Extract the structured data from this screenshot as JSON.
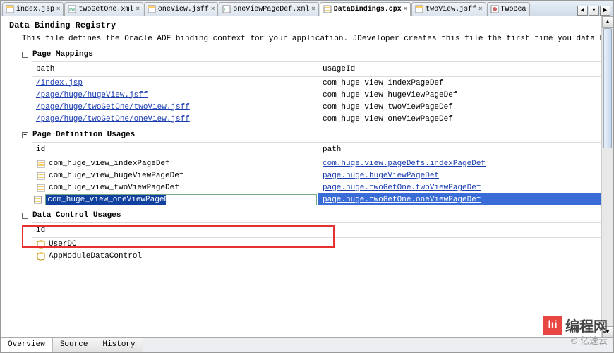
{
  "tabs": [
    {
      "label": "index.jsp",
      "icon": "jsp"
    },
    {
      "label": "twoGetOne.xml",
      "icon": "xml"
    },
    {
      "label": "oneView.jsff",
      "icon": "jsff"
    },
    {
      "label": "oneViewPageDef.xml",
      "icon": "xml"
    },
    {
      "label": "DataBindings.cpx",
      "icon": "cpx",
      "active": true
    },
    {
      "label": "twoView.jsff",
      "icon": "jsff"
    },
    {
      "label": "TwoBea",
      "icon": "java",
      "truncated": true
    }
  ],
  "tab_controls": [
    "◄",
    "▾",
    "►"
  ],
  "page": {
    "heading": "Data Binding Registry",
    "description": "This file defines the Oracle ADF binding context for your application. JDeveloper creates this file the first time you data bind a UI comp"
  },
  "sections": {
    "pageMappings": {
      "title": "Page Mappings",
      "cols": [
        "path",
        "usageId"
      ],
      "rows": [
        {
          "path": "/index.jsp",
          "usageId": "com_huge_view_indexPageDef"
        },
        {
          "path": "/page/huge/hugeView.jsff",
          "usageId": "com_huge_view_hugeViewPageDef"
        },
        {
          "path": "/page/huge/twoGetOne/twoView.jsff",
          "usageId": "com_huge_view_twoViewPageDef"
        },
        {
          "path": "/page/huge/twoGetOne/oneView.jsff",
          "usageId": "com_huge_view_oneViewPageDef"
        }
      ]
    },
    "pageDefUsages": {
      "title": "Page Definition Usages",
      "cols": [
        "id",
        "path"
      ],
      "rows": [
        {
          "id": "com_huge_view_indexPageDef",
          "path": "com.huge.view.pageDefs.indexPageDef"
        },
        {
          "id": "com_huge_view_hugeViewPageDef",
          "path": "page.huge.hugeViewPageDef"
        },
        {
          "id": "com_huge_view_twoViewPageDef",
          "path": "page.huge.twoGetOne.twoViewPageDef"
        },
        {
          "id": "com_huge_view_oneViewPageDef",
          "path": "page.huge.twoGetOne.oneViewPageDef",
          "selected": true,
          "editing": true
        }
      ]
    },
    "dataControlUsages": {
      "title": "Data Control Usages",
      "cols": [
        "id"
      ],
      "rows": [
        {
          "id": "UserDC"
        },
        {
          "id": "AppModuleDataControl"
        }
      ]
    }
  },
  "bottom_tabs": [
    {
      "label": "Overview",
      "active": true
    },
    {
      "label": "Source"
    },
    {
      "label": "History"
    }
  ],
  "toggle_glyph": "−",
  "close_glyph": "×",
  "watermark": {
    "logo": "lıi",
    "text": "编程网",
    "sub": "© 亿速云"
  }
}
